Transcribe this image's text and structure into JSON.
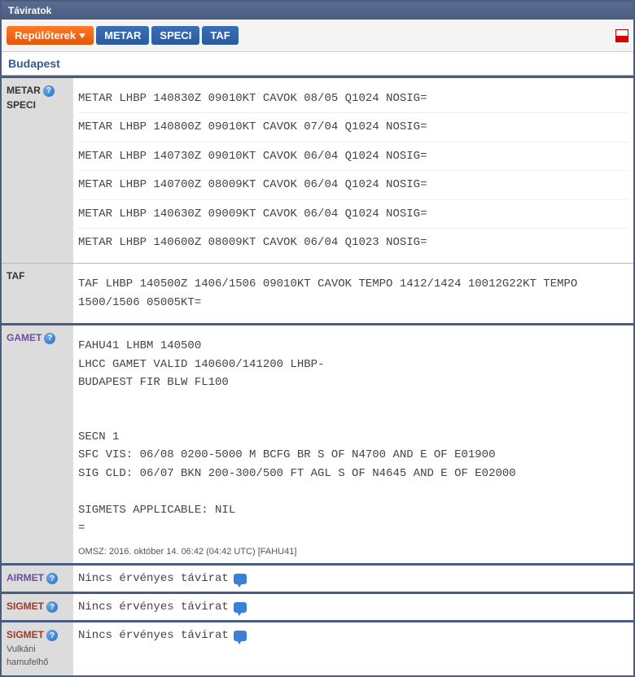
{
  "header": {
    "title": "Táviratok"
  },
  "toolbar": {
    "tabs": [
      "Repülőterek",
      "METAR",
      "SPECI",
      "TAF"
    ]
  },
  "city": "Budapest",
  "labels": {
    "metar_speci": [
      "METAR",
      "SPECI"
    ],
    "taf": "TAF",
    "gamet": "GAMET",
    "airmet": "AIRMET",
    "sigmet": "SIGMET",
    "sigmet_volcanic": [
      "SIGMET",
      "Vulkáni",
      "hamufelhő"
    ]
  },
  "metars": [
    "METAR LHBP 140830Z 09010KT CAVOK 08/05 Q1024 NOSIG=",
    "METAR LHBP 140800Z 09010KT CAVOK 07/04 Q1024 NOSIG=",
    "METAR LHBP 140730Z 09010KT CAVOK 06/04 Q1024 NOSIG=",
    "METAR LHBP 140700Z 08009KT CAVOK 06/04 Q1024 NOSIG=",
    "METAR LHBP 140630Z 09009KT CAVOK 06/04 Q1024 NOSIG=",
    "METAR LHBP 140600Z 08009KT CAVOK 06/04 Q1023 NOSIG="
  ],
  "taf": "TAF LHBP 140500Z 1406/1506 09010KT CAVOK TEMPO 1412/1424 10012G22KT TEMPO 1500/1506 05005KT=",
  "gamet": "FAHU41 LHBM 140500\nLHCC GAMET VALID 140600/141200 LHBP-\nBUDAPEST FIR BLW FL100\n\n\nSECN 1\nSFC VIS: 06/08 0200-5000 M BCFG BR S OF N4700 AND E OF E01900\nSIG CLD: 06/07 BKN 200-300/500 FT AGL S OF N4645 AND E OF E02000\n\nSIGMETS APPLICABLE: NIL\n=",
  "gamet_meta": "OMSZ: 2016. október 14. 06:42 (04:42 UTC)  [FAHU41]",
  "no_valid": "Nincs érvényes távirat"
}
